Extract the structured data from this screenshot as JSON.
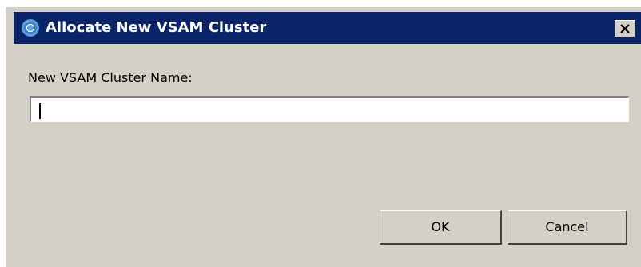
{
  "window": {
    "title": "Allocate New VSAM Cluster",
    "icon": "app-ring-icon",
    "title_color": "#0a246a"
  },
  "form": {
    "name_label": "New VSAM Cluster Name:",
    "name_value": ""
  },
  "buttons": {
    "ok_label": "OK",
    "cancel_label": "Cancel"
  },
  "close_icon": "close-icon"
}
